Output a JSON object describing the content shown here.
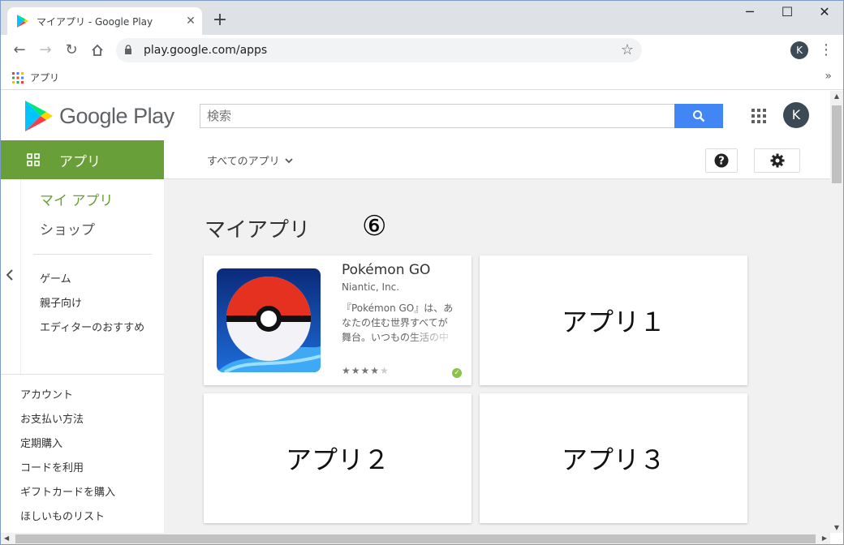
{
  "browser": {
    "tab_title": "マイアプリ - Google Play",
    "tab_close": "✕",
    "new_tab": "+",
    "url": "play.google.com/apps",
    "avatar_letter": "K",
    "bookmarks_apps_label": "アプリ",
    "bookmarks_more": "»",
    "window_controls": {
      "minimize": "─",
      "maximize": "☐",
      "close": "✕"
    }
  },
  "header": {
    "logo_text": "Google Play",
    "search_placeholder": "検索",
    "avatar_letter": "K"
  },
  "subbar": {
    "apps_tab_label": "アプリ",
    "all_apps_label": "すべてのアプリ"
  },
  "sidebar": {
    "primary": [
      {
        "label": "マイ アプリ",
        "active": true
      },
      {
        "label": "ショップ",
        "active": false
      }
    ],
    "categories": [
      "ゲーム",
      "親子向け",
      "エディターのおすすめ"
    ],
    "account_links": [
      "アカウント",
      "お支払い方法",
      "定期購入",
      "コードを利用",
      "ギフトカードを購入",
      "ほしいものリスト"
    ]
  },
  "main": {
    "title": "マイアプリ",
    "annotation": "⑥",
    "featured_app": {
      "name": "Pokémon GO",
      "developer": "Niantic, Inc.",
      "description_lines": [
        "『Pokémon GO』は、あ",
        "なたの住む世界すべてが",
        "舞台。いつもの生活の中"
      ],
      "rating_stars": 4,
      "max_stars": 5,
      "installed": true
    },
    "placeholders": [
      "アプリ１",
      "アプリ２",
      "アプリ３"
    ]
  },
  "colors": {
    "accent_green": "#689f38",
    "search_blue": "#4285f4",
    "installed_green": "#8bc34a"
  },
  "icons": [
    "play-store-logo-icon",
    "search-icon",
    "apps-grid-icon",
    "help-icon",
    "gear-icon",
    "chevron-down-icon",
    "chevron-left-icon",
    "star-icon",
    "lock-icon",
    "back-icon",
    "forward-icon",
    "reload-icon",
    "home-icon",
    "menu-dots-icon",
    "installed-check-icon"
  ]
}
